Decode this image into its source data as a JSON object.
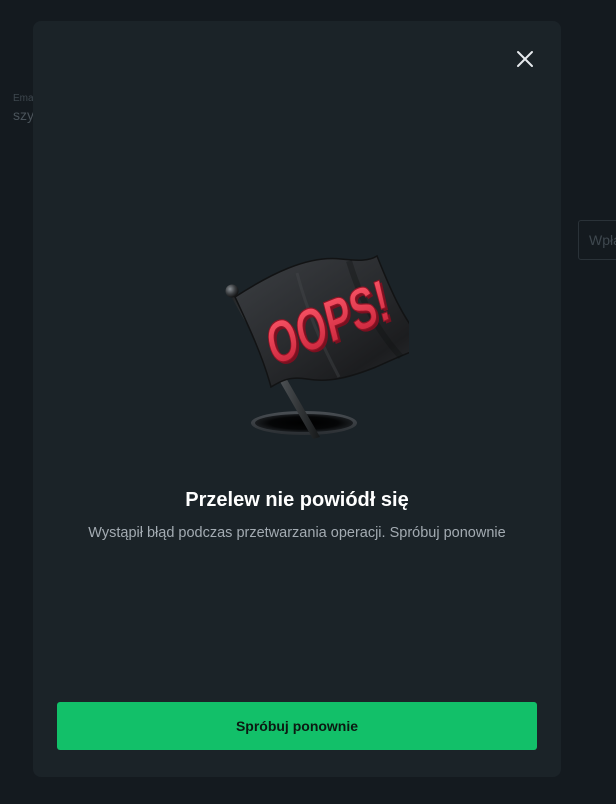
{
  "background": {
    "field_label": "Ema",
    "field_value": "szy",
    "input_placeholder": "Wpła"
  },
  "modal": {
    "close_icon": "close-icon",
    "illustration": {
      "icon": "oops-flag-icon",
      "flag_text": "OOPS!"
    },
    "title": "Przelew nie powiódł się",
    "message": "Wystąpił błąd podczas przetwarzania operacji. Spróbuj ponownie",
    "retry_button_label": "Spróbuj ponownie"
  },
  "colors": {
    "page_background": "#141a1f",
    "modal_background": "#1b2328",
    "primary_button": "#12c069",
    "title_text": "#ffffff",
    "message_text": "#a3abb2",
    "flag_lettering": "#e8344a"
  }
}
